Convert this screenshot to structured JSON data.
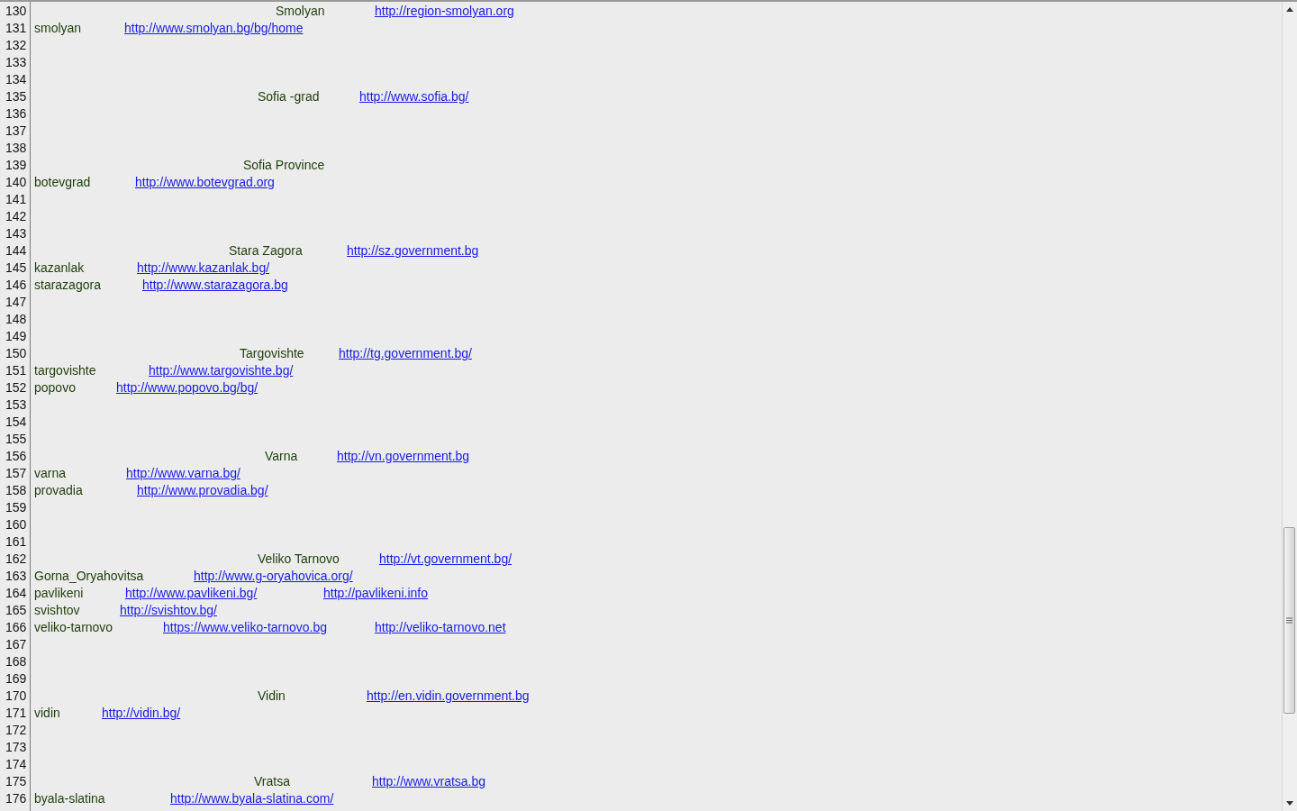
{
  "lines": [
    {
      "number": "130",
      "cells": [
        {
          "kind": "text",
          "text": "Smolyan"
        },
        {
          "kind": "link",
          "text": "http://region-smolyan.org"
        }
      ]
    },
    {
      "number": "131",
      "cells": [
        {
          "kind": "text",
          "text": "smolyan"
        },
        {
          "kind": "link",
          "text": "http://www.smolyan.bg/bg/home"
        }
      ]
    },
    {
      "number": "132"
    },
    {
      "number": "133"
    },
    {
      "number": "134"
    },
    {
      "number": "135",
      "cells": [
        {
          "kind": "text",
          "text": "Sofia -grad"
        },
        {
          "kind": "link",
          "text": "http://www.sofia.bg/"
        }
      ]
    },
    {
      "number": "136"
    },
    {
      "number": "137"
    },
    {
      "number": "138"
    },
    {
      "number": "139",
      "cells": [
        {
          "kind": "text",
          "text": "Sofia Province"
        }
      ]
    },
    {
      "number": "140",
      "cells": [
        {
          "kind": "text",
          "text": "botevgrad"
        },
        {
          "kind": "link",
          "text": "http://www.botevgrad.org"
        }
      ]
    },
    {
      "number": "141"
    },
    {
      "number": "142"
    },
    {
      "number": "143"
    },
    {
      "number": "144",
      "cells": [
        {
          "kind": "text",
          "text": "Stara Zagora"
        },
        {
          "kind": "link",
          "text": "http://sz.government.bg"
        }
      ]
    },
    {
      "number": "145",
      "cells": [
        {
          "kind": "text",
          "text": "kazanlak"
        },
        {
          "kind": "link",
          "text": "http://www.kazanlak.bg/"
        }
      ]
    },
    {
      "number": "146",
      "cells": [
        {
          "kind": "text",
          "text": "starazagora"
        },
        {
          "kind": "link",
          "text": "http://www.starazagora.bg"
        }
      ]
    },
    {
      "number": "147"
    },
    {
      "number": "148"
    },
    {
      "number": "149"
    },
    {
      "number": "150",
      "cells": [
        {
          "kind": "text",
          "text": "Targovishte"
        },
        {
          "kind": "link",
          "text": "http://tg.government.bg/"
        }
      ]
    },
    {
      "number": "151",
      "cells": [
        {
          "kind": "text",
          "text": "targovishte"
        },
        {
          "kind": "link",
          "text": "http://www.targovishte.bg/"
        }
      ]
    },
    {
      "number": "152",
      "cells": [
        {
          "kind": "text",
          "text": "popovo"
        },
        {
          "kind": "link",
          "text": "http://www.popovo.bg/bg/"
        }
      ]
    },
    {
      "number": "153"
    },
    {
      "number": "154"
    },
    {
      "number": "155"
    },
    {
      "number": "156",
      "cells": [
        {
          "kind": "text",
          "text": "Varna"
        },
        {
          "kind": "link",
          "text": "http://vn.government.bg"
        }
      ]
    },
    {
      "number": "157",
      "cells": [
        {
          "kind": "text",
          "text": "varna"
        },
        {
          "kind": "link",
          "text": "http://www.varna.bg/"
        }
      ]
    },
    {
      "number": "158",
      "cells": [
        {
          "kind": "text",
          "text": "provadia"
        },
        {
          "kind": "link",
          "text": "http://www.provadia.bg/"
        }
      ]
    },
    {
      "number": "159"
    },
    {
      "number": "160"
    },
    {
      "number": "161"
    },
    {
      "number": "162",
      "cells": [
        {
          "kind": "text",
          "text": "Veliko Tarnovo"
        },
        {
          "kind": "link",
          "text": "http://vt.government.bg/"
        }
      ]
    },
    {
      "number": "163",
      "cells": [
        {
          "kind": "text",
          "text": "Gorna_Oryahovitsa"
        },
        {
          "kind": "link",
          "text": "http://www.g-oryahovica.org/"
        }
      ]
    },
    {
      "number": "164",
      "cells": [
        {
          "kind": "text",
          "text": "pavlikeni"
        },
        {
          "kind": "link",
          "text": "http://www.pavlikeni.bg/"
        },
        {
          "kind": "link",
          "text": "http://pavlikeni.info"
        }
      ]
    },
    {
      "number": "165",
      "cells": [
        {
          "kind": "text",
          "text": "svishtov"
        },
        {
          "kind": "link",
          "text": "http://svishtov.bg/"
        }
      ]
    },
    {
      "number": "166",
      "cells": [
        {
          "kind": "text",
          "text": "veliko-tarnovo"
        },
        {
          "kind": "link",
          "text": "https://www.veliko-tarnovo.bg"
        },
        {
          "kind": "link",
          "text": "http://veliko-tarnovo.net"
        }
      ]
    },
    {
      "number": "167"
    },
    {
      "number": "168"
    },
    {
      "number": "169"
    },
    {
      "number": "170",
      "cells": [
        {
          "kind": "text",
          "text": "Vidin"
        },
        {
          "kind": "link",
          "text": "http://en.vidin.government.bg"
        }
      ]
    },
    {
      "number": "171",
      "cells": [
        {
          "kind": "text",
          "text": "vidin"
        },
        {
          "kind": "link",
          "text": "http://vidin.bg/"
        }
      ]
    },
    {
      "number": "172"
    },
    {
      "number": "173"
    },
    {
      "number": "174"
    },
    {
      "number": "175",
      "cells": [
        {
          "kind": "text",
          "text": "Vratsa"
        },
        {
          "kind": "link",
          "text": "http://www.vratsa.bg"
        }
      ]
    },
    {
      "number": "176",
      "cells": [
        {
          "kind": "text",
          "text": "byala-slatina"
        },
        {
          "kind": "link",
          "text": "http://www.byala-slatina.com/"
        }
      ]
    }
  ]
}
